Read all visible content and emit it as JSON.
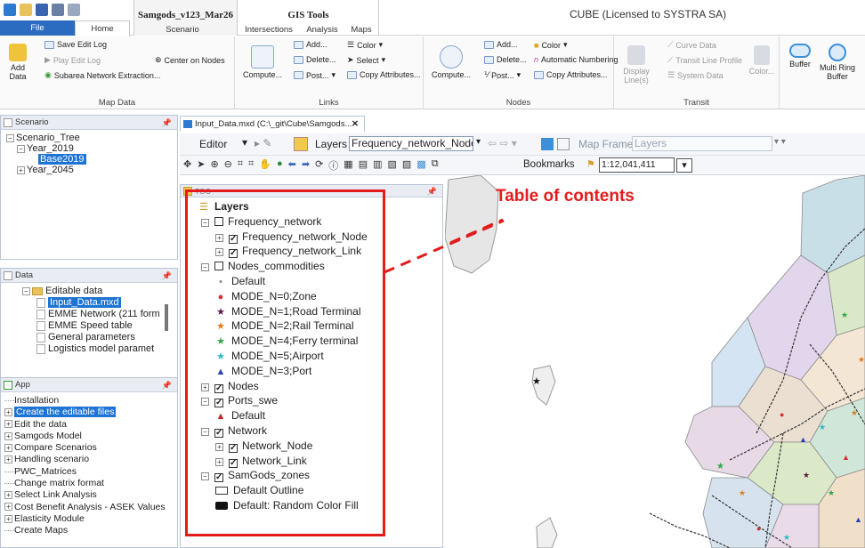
{
  "title_bar": {
    "document_tab": "Samgods_v123_Mar26",
    "context_tab": "GIS Tools",
    "app_title": "CUBE (Licensed to SYSTRA SA)"
  },
  "ribbon_tabs": {
    "file": "File",
    "home": "Home",
    "scenario": "Scenario",
    "intersections": "Intersections",
    "analysis": "Analysis",
    "maps": "Maps"
  },
  "ribbon": {
    "map_data": {
      "label": "Map Data",
      "add_data": "Add\nData",
      "save_edit_log": "Save Edit Log",
      "play_edit_log": "Play Edit Log",
      "subarea": "Subarea Network Extraction...",
      "center_on_nodes": "Center on Nodes"
    },
    "links": {
      "label": "Links",
      "compute": "Compute...",
      "add": "Add...",
      "delete": "Delete...",
      "post": "Post...",
      "color": "Color",
      "select": "Select",
      "copy_attributes": "Copy Attributes..."
    },
    "nodes": {
      "label": "Nodes",
      "compute": "Compute...",
      "add": "Add...",
      "delete": "Delete...",
      "post": "Post...",
      "color": "Color",
      "auto_numbering": "Automatic Numbering",
      "copy_attributes": "Copy Attributes..."
    },
    "transit": {
      "label": "Transit",
      "display_lines": "Display\nLine(s)",
      "curve_data": "Curve Data",
      "transit_line_profile": "Transit Line Profile",
      "system_data": "System Data",
      "color": "Color..."
    },
    "buffer": "Buffer",
    "multi_ring_buffer": "Multi Ring\nBuffer"
  },
  "scenario_panel": {
    "header": "Scenario",
    "root": "Scenario_Tree",
    "year2019": "Year_2019",
    "base2019": "Base2019",
    "year2045": "Year_2045"
  },
  "data_panel": {
    "header": "Data",
    "folder": "Editable data",
    "items": [
      "Input_Data.mxd",
      "EMME Network (211 form",
      "EMME Speed table",
      "General parameters",
      "Logistics model paramet"
    ]
  },
  "app_panel": {
    "header": "App",
    "items": [
      "Installation",
      "Create the editable files",
      "Edit the data",
      "Samgods Model",
      "Compare Scenarios",
      "Handling scenario",
      "PWC_Matrices",
      "Change matrix format",
      "Select Link Analysis",
      "Cost Benefit Analysis - ASEK Values",
      "Elasticity Module",
      "Create Maps"
    ]
  },
  "document": {
    "tab_label": "Input_Data.mxd (C:\\_git\\Cube\\Samgods...",
    "close": "✕"
  },
  "toolbar": {
    "editor": "Editor",
    "layers_label": "Layers",
    "layers_value": "Frequency_network_Node",
    "map_frame_label": "Map Frame",
    "map_frame_value": "Layers",
    "bookmarks": "Bookmarks",
    "scale": "1:12,041,411"
  },
  "toc": {
    "header": "TOC",
    "root": "Layers",
    "rows": [
      "Frequency_network",
      "Frequency_network_Node",
      "Frequency_network_Link",
      "Nodes_commodities",
      "Default",
      "MODE_N=0;Zone",
      "MODE_N=1;Road Terminal",
      "MODE_N=2;Rail Terminal",
      "MODE_N=4;Ferry terminal",
      "MODE_N=5;Airport",
      "MODE_N=3;Port",
      "Nodes",
      "Ports_swe",
      "Default",
      "Network",
      "Network_Node",
      "Network_Link",
      "SamGods_zones",
      "Default Outline",
      "Default: Random Color Fill"
    ]
  },
  "annotation": {
    "label": "Table of contents"
  },
  "colors": {
    "accent_blue": "#1e74d4",
    "annotation_red": "#e31b1b",
    "file_tab": "#2b6cc1"
  }
}
